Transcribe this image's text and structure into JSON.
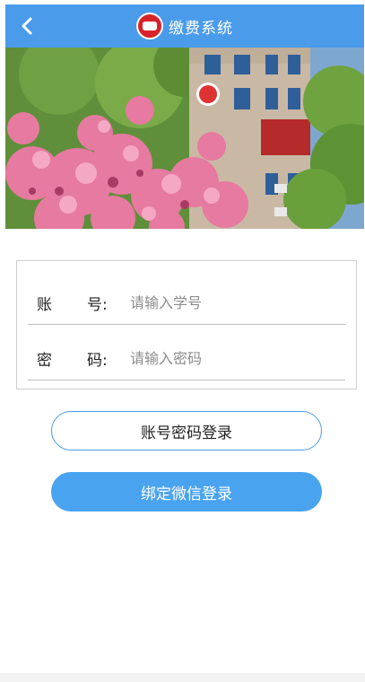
{
  "header": {
    "title": "缴费系统",
    "back_icon": "chevron-left-icon",
    "logo_icon": "school-emblem-icon",
    "color": "#4a9bea"
  },
  "banner": {
    "description_icon": "campus-photo"
  },
  "form": {
    "account": {
      "label_part1": "账",
      "label_part2": "号:",
      "placeholder": "请输入学号"
    },
    "password": {
      "label_part1": "密",
      "label_part2": "码:",
      "placeholder": "请输入密码"
    }
  },
  "buttons": {
    "account_login": "账号密码登录",
    "wechat_login": "绑定微信登录"
  }
}
